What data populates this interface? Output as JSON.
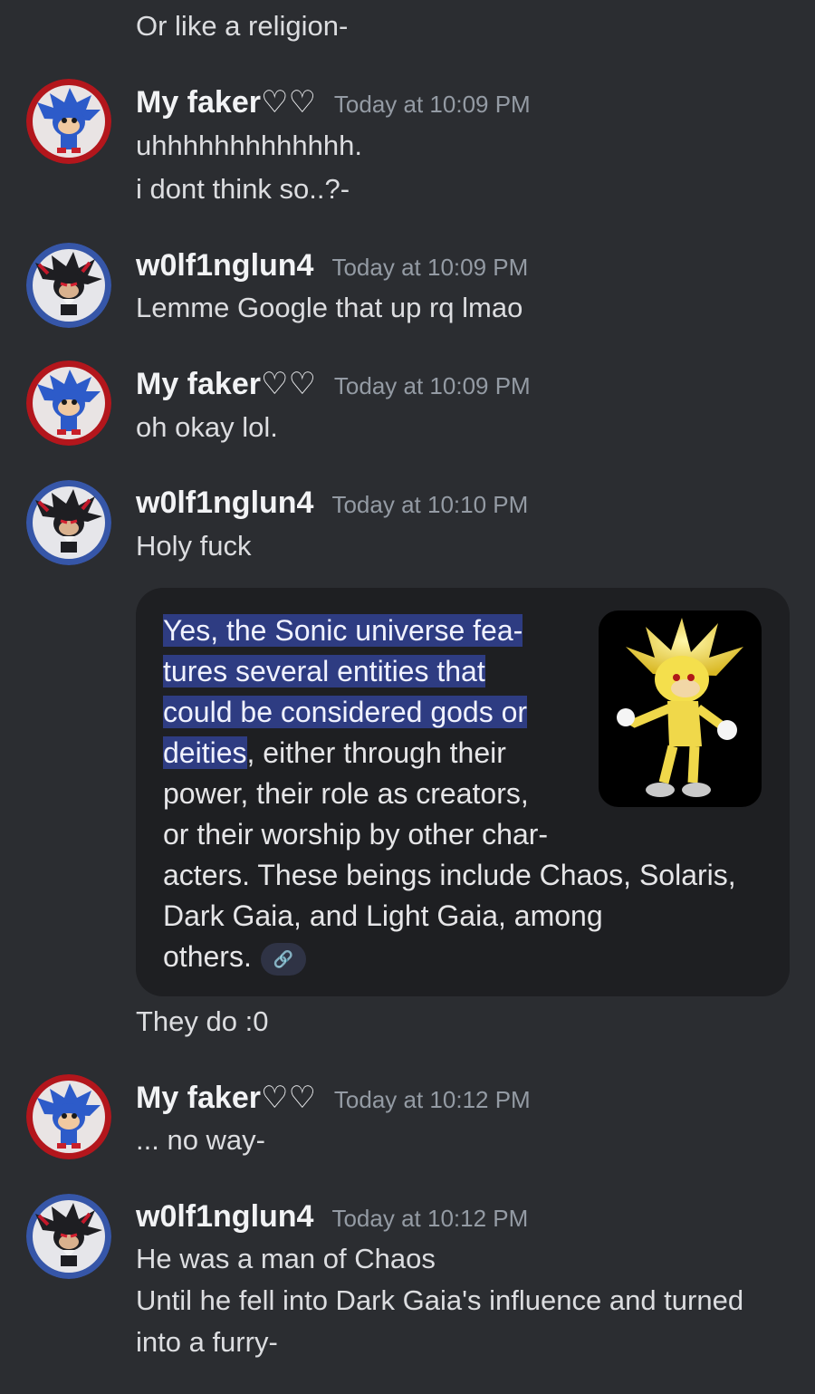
{
  "messages": {
    "m0": {
      "line1": "Or like a religion-"
    },
    "m1": {
      "username": "My faker♡♡",
      "timestamp": "Today at 10:09 PM",
      "line1": "uhhhhhhhhhhhhh.",
      "line2": "i dont think so..?-"
    },
    "m2": {
      "username": "w0lf1nglun4",
      "timestamp": "Today at 10:09 PM",
      "line1": "Lemme Google that up rq lmao"
    },
    "m3": {
      "username": "My faker♡♡",
      "timestamp": "Today at 10:09 PM",
      "line1": "oh okay lol."
    },
    "m4": {
      "username": "w0lf1nglun4",
      "timestamp": "Today at 10:10 PM",
      "line1": "Holy fuck",
      "after_embed": "They do :0"
    },
    "m5": {
      "username": "My faker♡♡",
      "timestamp": "Today at 10:12 PM",
      "line1": "... no way-"
    },
    "m6": {
      "username": "w0lf1nglun4",
      "timestamp": "Today at 10:12 PM",
      "line1": "He was a man of Chaos",
      "line2": "Until he fell into Dark Gaia's influence and turned",
      "line3": "into a furry-"
    }
  },
  "embed": {
    "l1": "Yes, the Sonic universe fea-",
    "l2": "tures several entities that",
    "l3": "could be considered gods or",
    "l4a": "deities",
    "l4b": ", either through their",
    "l5": "power, their role as creators,",
    "l6": "or their worship by other char-",
    "l7": "acters. These beings include Chaos, Solaris,",
    "l8": "Dark Gaia, and Light Gaia, among",
    "l9": "others.",
    "link_icon": "link-icon",
    "thumbnail": "super-sonic-image"
  },
  "colors": {
    "background": "#2b2d31",
    "embed_bg": "#1e1f22",
    "highlight": "#2e3c82",
    "timestamp": "#949ba4"
  }
}
